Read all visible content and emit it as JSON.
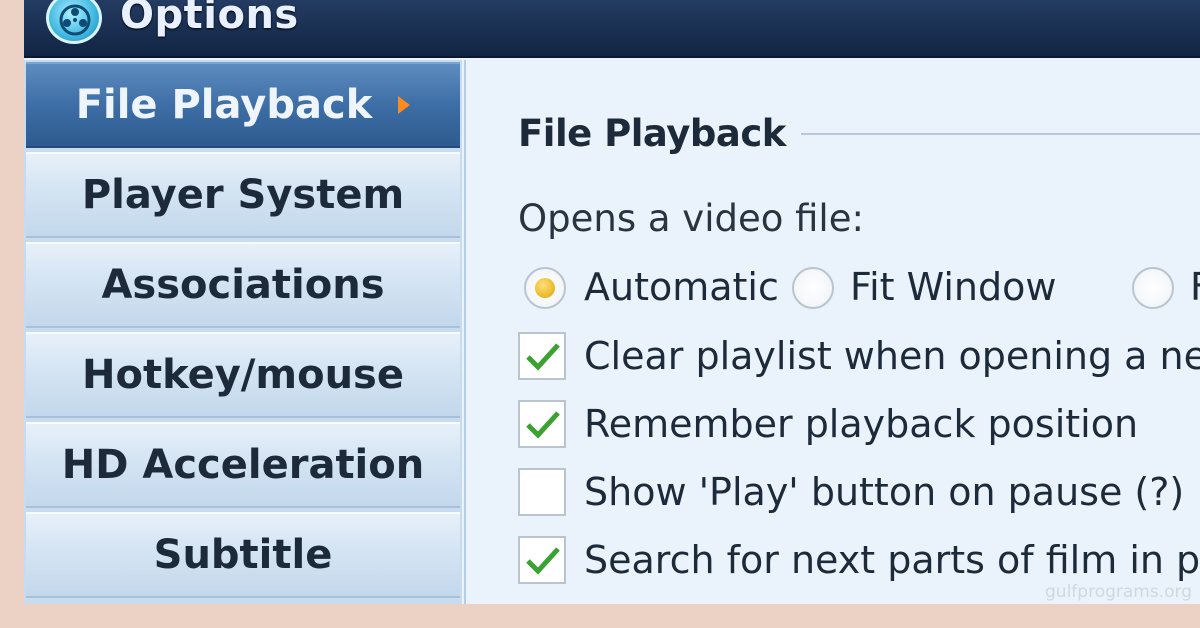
{
  "window": {
    "title": "Options",
    "icon": "film-reel-icon"
  },
  "sidebar": {
    "items": [
      {
        "label": "File Playback",
        "active": true
      },
      {
        "label": "Player System",
        "active": false
      },
      {
        "label": "Associations",
        "active": false
      },
      {
        "label": "Hotkey/mouse",
        "active": false
      },
      {
        "label": "HD Acceleration",
        "active": false
      },
      {
        "label": "Subtitle",
        "active": false
      }
    ]
  },
  "panel": {
    "section_title": "File Playback",
    "opens_label": "Opens a video file:",
    "radios": [
      {
        "label": "Automatic",
        "checked": true
      },
      {
        "label": "Fit Window",
        "checked": false
      },
      {
        "label": "F",
        "checked": false
      }
    ],
    "checkboxes": [
      {
        "label": "Clear playlist when opening a new",
        "checked": true
      },
      {
        "label": "Remember playback position",
        "checked": true
      },
      {
        "label": "Show 'Play' button on pause (?)",
        "checked": false
      },
      {
        "label": "Search for next parts of film in pl",
        "checked": true
      }
    ]
  },
  "watermark": "gulfprograms.org",
  "colors": {
    "background": "#ecd2c4",
    "active_nav": "#3d6ea5",
    "checkmark": "#3aa22e",
    "radio_dot": "#e0a400"
  }
}
